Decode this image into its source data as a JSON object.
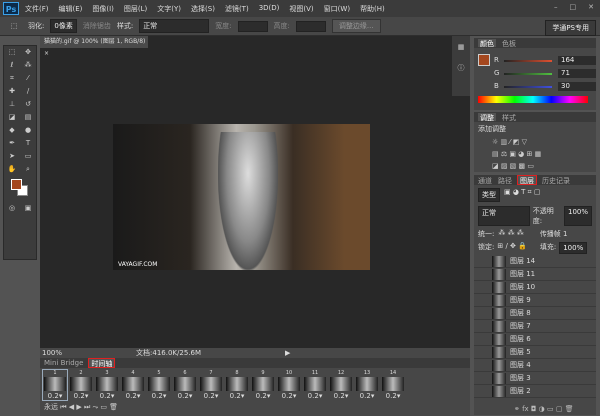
{
  "app": {
    "logo": "Ps",
    "menu": [
      "文件(F)",
      "编辑(E)",
      "图像(I)",
      "图层(L)",
      "文字(Y)",
      "选择(S)",
      "滤镜(T)",
      "3D(D)",
      "视图(V)",
      "窗口(W)",
      "帮助(H)"
    ],
    "window_controls": [
      "–",
      "□",
      "✕"
    ]
  },
  "options": {
    "feather_label": "羽化:",
    "feather_value": "0像素",
    "antialias": "消除锯齿",
    "style_label": "样式:",
    "style_value": "正常",
    "width_label": "宽度:",
    "height_label": "高度:",
    "refine_edge": "调整边缘...",
    "workspace": "学通PS专用"
  },
  "document": {
    "tab": "猫猫的.gif @ 100% (图层 1, RGB/8) ×",
    "watermark": "VAYAGIF.COM",
    "zoom": "100%",
    "doc_info": "文档:416.0K/25.6M"
  },
  "color_panel": {
    "tabs": [
      "颜色",
      "色板"
    ],
    "channels": [
      {
        "label": "R",
        "value": "164",
        "color": "#e05030"
      },
      {
        "label": "G",
        "value": "71",
        "color": "#50c040"
      },
      {
        "label": "B",
        "value": "30",
        "color": "#4050e0"
      }
    ],
    "foreground": "#a4471e"
  },
  "adjustments": {
    "tabs": [
      "调整",
      "样式"
    ],
    "title": "添加调整"
  },
  "layers_panel": {
    "tabs": [
      "通道",
      "路径",
      "图层",
      "历史记录"
    ],
    "active_tab": "图层",
    "kind": "类型",
    "blend": "正常",
    "opacity_label": "不透明度:",
    "opacity": "100%",
    "unify": "统一:",
    "propagate": "传播帧 1",
    "lock": "锁定:",
    "fill_label": "填充:",
    "fill": "100%",
    "layers": [
      "图层 14",
      "图层 11",
      "图层 10",
      "图层 9",
      "图层 8",
      "图层 7",
      "图层 6",
      "图层 5",
      "图层 4",
      "图层 3",
      "图层 2"
    ]
  },
  "timeline": {
    "tabs": [
      "Mini Bridge",
      "时间轴"
    ],
    "active_tab": "时间轴",
    "frames": [
      {
        "n": "1",
        "d": "0.2"
      },
      {
        "n": "2",
        "d": "0.2"
      },
      {
        "n": "3",
        "d": "0.2"
      },
      {
        "n": "4",
        "d": "0.2"
      },
      {
        "n": "5",
        "d": "0.2"
      },
      {
        "n": "6",
        "d": "0.2"
      },
      {
        "n": "7",
        "d": "0.2"
      },
      {
        "n": "8",
        "d": "0.2"
      },
      {
        "n": "9",
        "d": "0.2"
      },
      {
        "n": "10",
        "d": "0.2"
      },
      {
        "n": "11",
        "d": "0.2"
      },
      {
        "n": "12",
        "d": "0.2"
      },
      {
        "n": "13",
        "d": "0.2"
      },
      {
        "n": "14",
        "d": "0.2"
      }
    ],
    "loop": "永远"
  }
}
